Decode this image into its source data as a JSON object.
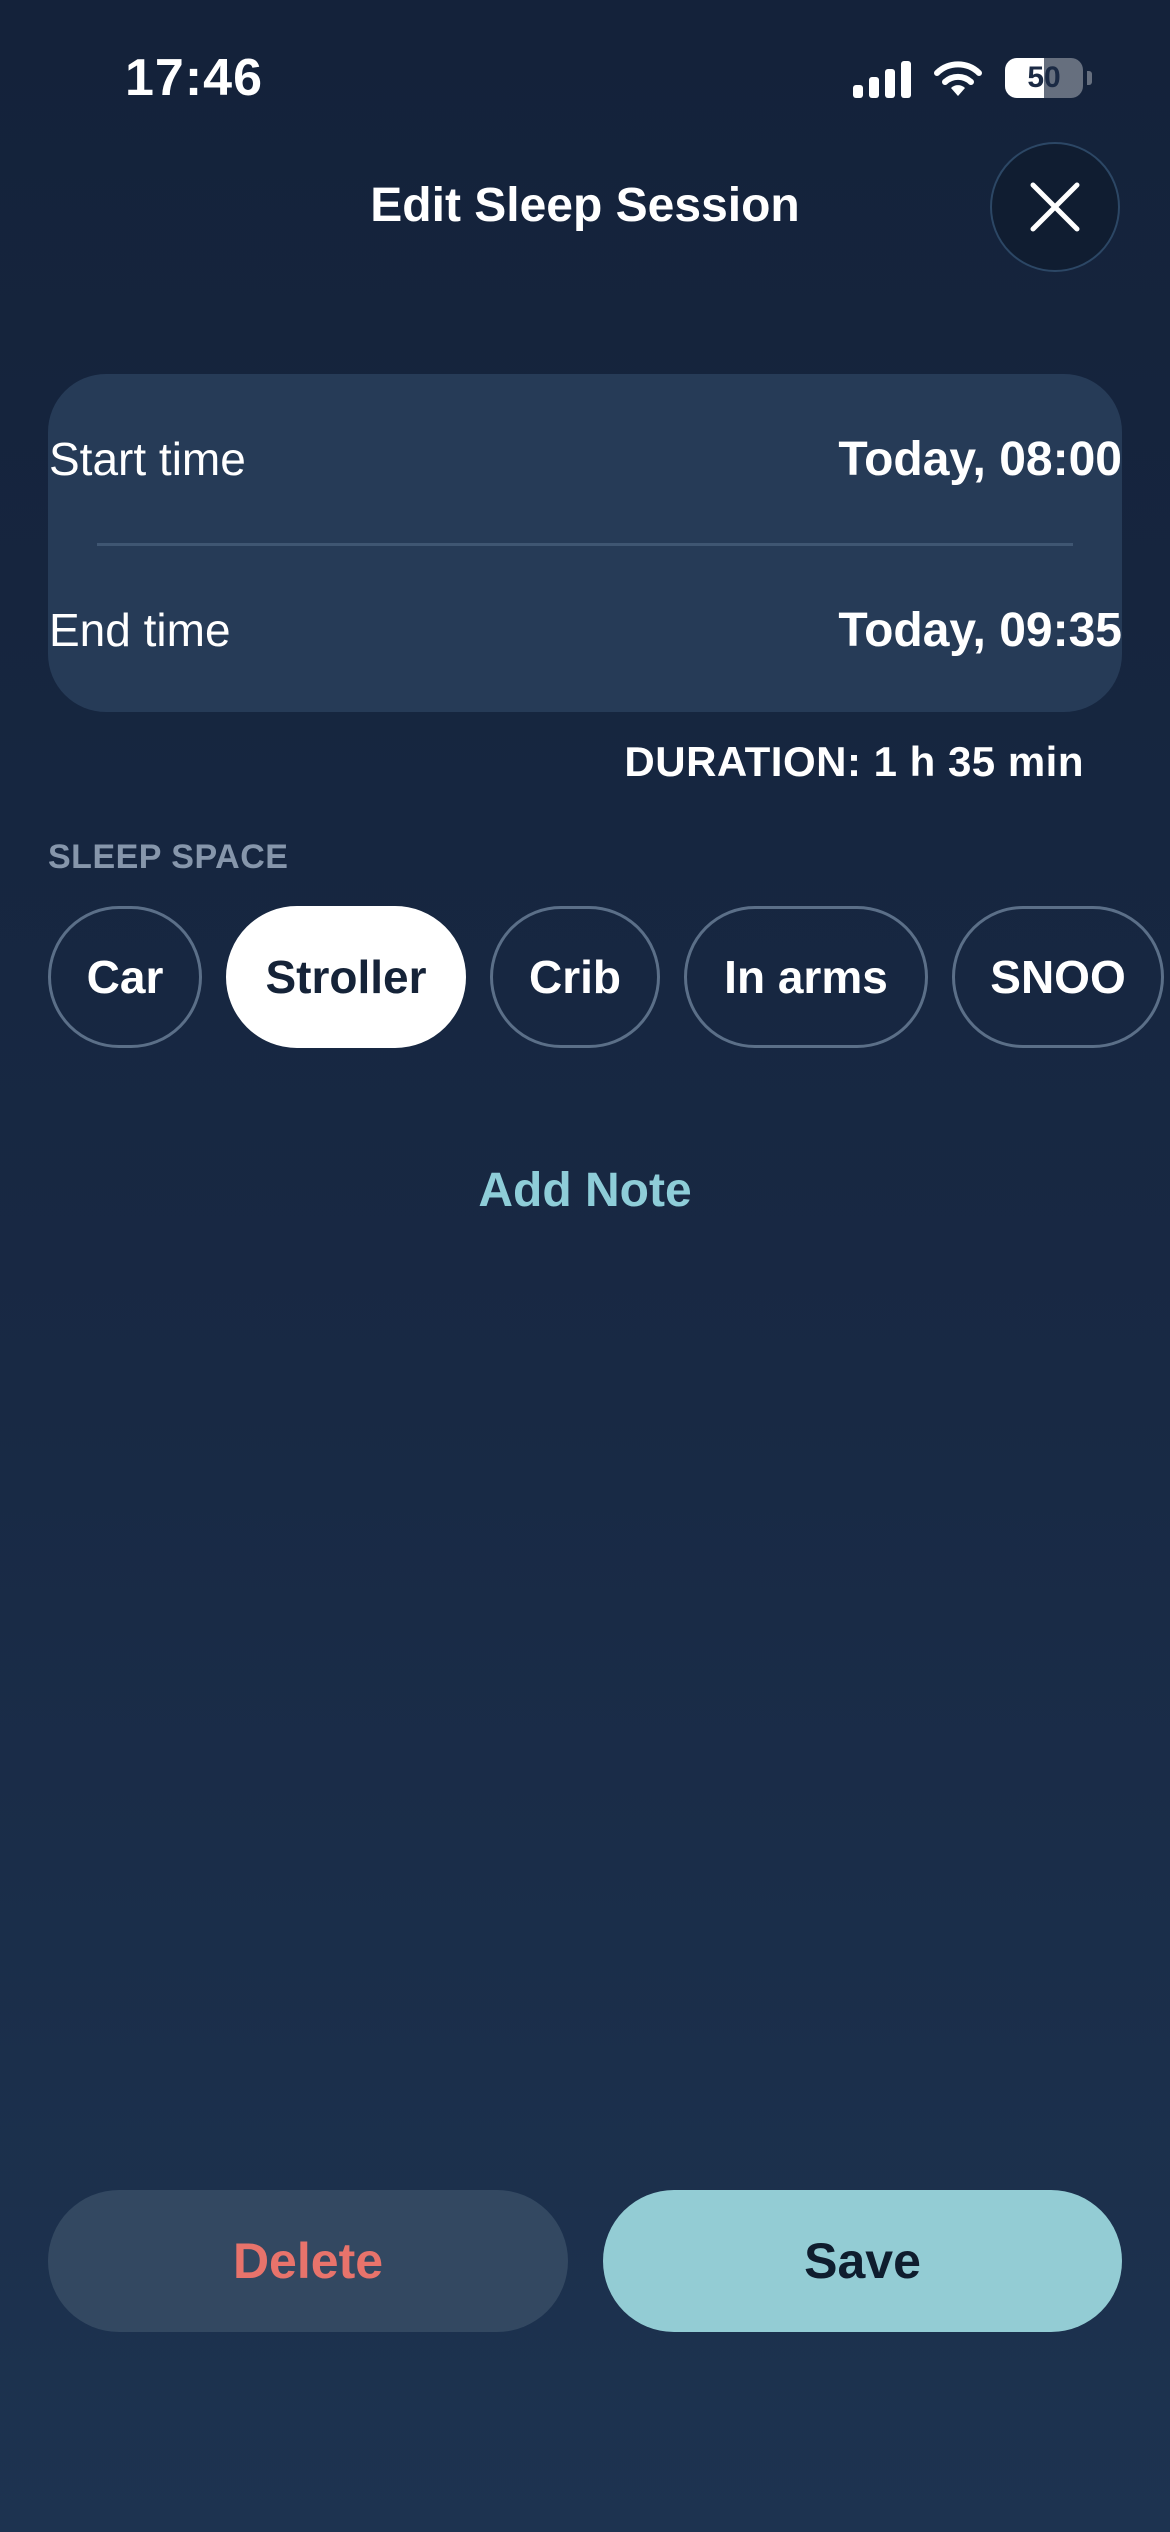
{
  "status_bar": {
    "time": "17:46",
    "battery_level": "50",
    "battery_fraction": 0.5,
    "icons": [
      "signal-icon",
      "wifi-icon",
      "battery-icon"
    ]
  },
  "header": {
    "title": "Edit Sleep Session",
    "close_icon": "close-icon"
  },
  "times": {
    "start_label": "Start time",
    "start_value": "Today, 08:00",
    "end_label": "End time",
    "end_value": "Today, 09:35"
  },
  "duration": "DURATION: 1 h 35 min",
  "sleep_space": {
    "label": "SLEEP SPACE",
    "options": [
      "Car",
      "Stroller",
      "Crib",
      "In arms",
      "SNOO"
    ],
    "selected": "Stroller"
  },
  "add_note": "Add Note",
  "actions": {
    "delete": "Delete",
    "save": "Save"
  },
  "colors": {
    "background": "#182944",
    "card": "#263b57",
    "accent": "#93ccd4",
    "link": "#8ecdd8",
    "danger": "#e8736b"
  }
}
